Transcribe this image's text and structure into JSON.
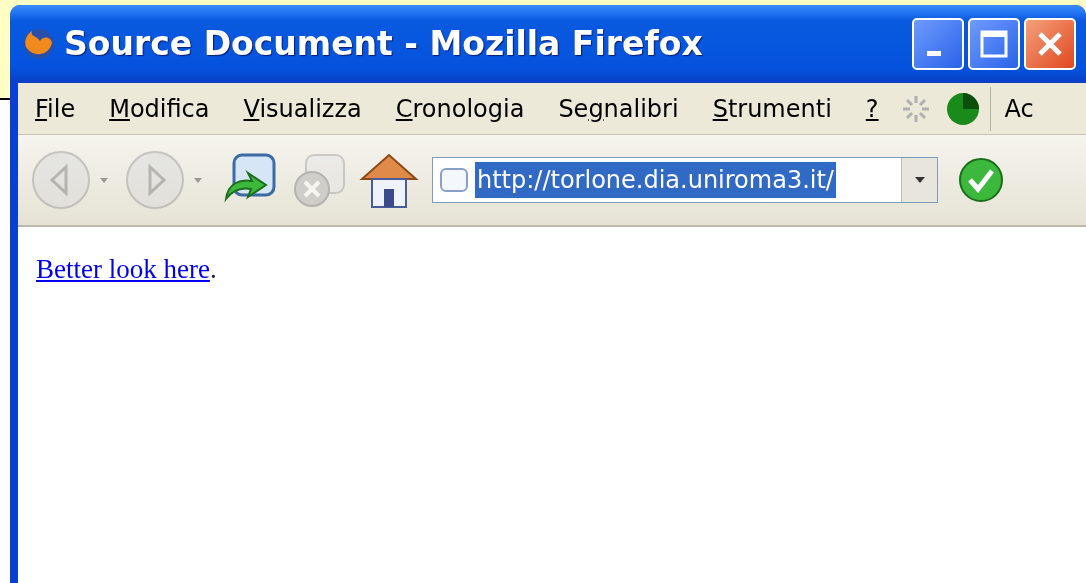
{
  "window": {
    "title": "Source Document - Mozilla Firefox"
  },
  "menu": [
    {
      "key": "F",
      "after": "ile"
    },
    {
      "key": "M",
      "after": "odifica"
    },
    {
      "key": "V",
      "after": "isualizza"
    },
    {
      "key": "C",
      "after": "ronologia"
    },
    {
      "before": "Se",
      "key": "g",
      "after": "nalibri"
    },
    {
      "key": "S",
      "after": "trumenti"
    },
    {
      "key": "?"
    }
  ],
  "toolbar_label": "Ac",
  "nav_buttons": [
    {
      "kind": "back",
      "disabled": true
    },
    {
      "kind": "forward",
      "disabled": true
    },
    {
      "kind": "reload",
      "disabled": false
    },
    {
      "kind": "stop",
      "disabled": true
    },
    {
      "kind": "home",
      "disabled": false
    }
  ],
  "url": {
    "value": "http://torlone.dia.uniroma3.it/",
    "selected": true
  },
  "content": {
    "link": "Better look here",
    "after": "."
  }
}
